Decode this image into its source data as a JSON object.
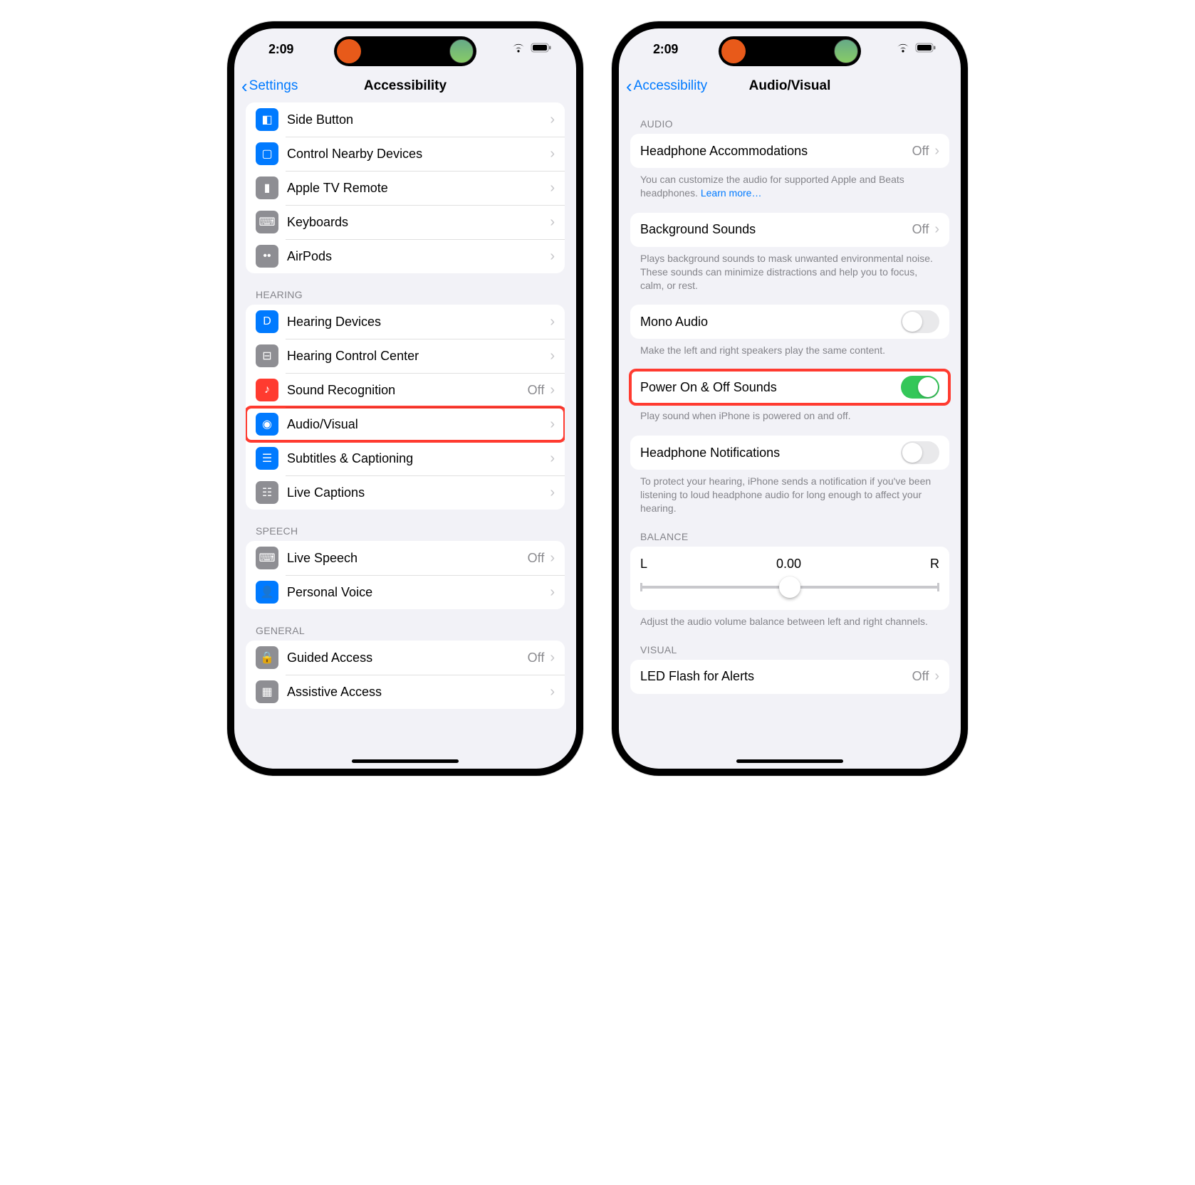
{
  "status": {
    "time": "2:09"
  },
  "left": {
    "back": "Settings",
    "title": "Accessibility",
    "groups": [
      {
        "header": "",
        "rows": [
          {
            "icon": "bg-blue",
            "name": "side-button",
            "glyph": "◧",
            "label": "Side Button"
          },
          {
            "icon": "bg-blue",
            "name": "control-nearby",
            "glyph": "▢",
            "label": "Control Nearby Devices"
          },
          {
            "icon": "bg-gray",
            "name": "apple-tv-remote",
            "glyph": "▮",
            "label": "Apple TV Remote"
          },
          {
            "icon": "bg-gray",
            "name": "keyboards",
            "glyph": "⌨",
            "label": "Keyboards"
          },
          {
            "icon": "bg-gray",
            "name": "airpods",
            "glyph": "••",
            "label": "AirPods"
          }
        ]
      },
      {
        "header": "HEARING",
        "rows": [
          {
            "icon": "bg-blue",
            "name": "hearing-devices",
            "glyph": "D",
            "label": "Hearing Devices"
          },
          {
            "icon": "bg-gray",
            "name": "hearing-control",
            "glyph": "⊟",
            "label": "Hearing Control Center"
          },
          {
            "icon": "bg-red",
            "name": "sound-recognition",
            "glyph": "♪",
            "label": "Sound Recognition",
            "detail": "Off"
          },
          {
            "icon": "bg-blue",
            "name": "audio-visual",
            "glyph": "◉",
            "label": "Audio/Visual",
            "highlight": true
          },
          {
            "icon": "bg-blue",
            "name": "subtitles",
            "glyph": "☰",
            "label": "Subtitles & Captioning"
          },
          {
            "icon": "bg-gray",
            "name": "live-captions",
            "glyph": "☷",
            "label": "Live Captions"
          }
        ]
      },
      {
        "header": "SPEECH",
        "rows": [
          {
            "icon": "bg-gray",
            "name": "live-speech",
            "glyph": "⌨",
            "label": "Live Speech",
            "detail": "Off"
          },
          {
            "icon": "bg-blue",
            "name": "personal-voice",
            "glyph": "👤",
            "label": "Personal Voice"
          }
        ]
      },
      {
        "header": "GENERAL",
        "rows": [
          {
            "icon": "bg-gray",
            "name": "guided-access",
            "glyph": "🔒",
            "label": "Guided Access",
            "detail": "Off"
          },
          {
            "icon": "bg-gray",
            "name": "assistive-access",
            "glyph": "▦",
            "label": "Assistive Access"
          }
        ]
      }
    ]
  },
  "right": {
    "back": "Accessibility",
    "title": "Audio/Visual",
    "sections": {
      "audio_header": "AUDIO",
      "headphone_accom": {
        "label": "Headphone Accommodations",
        "detail": "Off"
      },
      "headphone_accom_footer": "You can customize the audio for supported Apple and Beats headphones. ",
      "learn_more": "Learn more…",
      "bg_sounds": {
        "label": "Background Sounds",
        "detail": "Off"
      },
      "bg_sounds_footer": "Plays background sounds to mask unwanted environmental noise. These sounds can minimize distractions and help you to focus, calm, or rest.",
      "mono": {
        "label": "Mono Audio",
        "on": false
      },
      "mono_footer": "Make the left and right speakers play the same content.",
      "power": {
        "label": "Power On & Off Sounds",
        "on": true,
        "highlight": true
      },
      "power_footer": "Play sound when iPhone is powered on and off.",
      "hp_notif": {
        "label": "Headphone Notifications",
        "on": false
      },
      "hp_notif_footer": "To protect your hearing, iPhone sends a notification if you've been listening to loud headphone audio for long enough to affect your hearing.",
      "balance_header": "BALANCE",
      "balance": {
        "left": "L",
        "value": "0.00",
        "right": "R"
      },
      "balance_footer": "Adjust the audio volume balance between left and right channels.",
      "visual_header": "VISUAL",
      "led": {
        "label": "LED Flash for Alerts",
        "detail": "Off"
      }
    }
  }
}
